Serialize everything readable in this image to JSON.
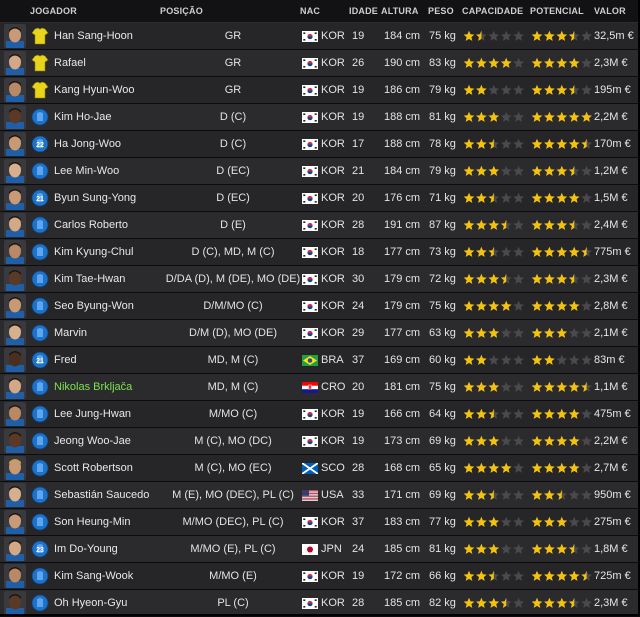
{
  "columns": {
    "player": "JOGADOR",
    "position": "POSIÇÃO",
    "nat": "NAC",
    "age": "IDADE",
    "height": "ALTURA",
    "weight": "PESO",
    "ability": "CAPACIDADE",
    "potential": "POTENCIAL",
    "value": "VALOR"
  },
  "colors": {
    "star_gold": "#f2c20f",
    "star_empty": "#4a4a4e",
    "highlight_name": "#7ee04f",
    "kit_gk": "#e8d41a",
    "kit_outfield": "#1e73c8"
  },
  "players": [
    {
      "name": "Han Sang-Hoon",
      "kit": "gk",
      "number": "",
      "position": "GR",
      "flag": "kor",
      "nat": "KOR",
      "age": "19",
      "height": "184 cm",
      "weight": "75 kg",
      "ability": 1.5,
      "potential": 3.5,
      "value": "32,5m €",
      "highlight": false
    },
    {
      "name": "Rafael",
      "kit": "gk",
      "number": "",
      "position": "GR",
      "flag": "kor",
      "nat": "KOR",
      "age": "26",
      "height": "190 cm",
      "weight": "83 kg",
      "ability": 4,
      "potential": 4,
      "value": "2,3M €",
      "highlight": false
    },
    {
      "name": "Kang Hyun-Woo",
      "kit": "gk",
      "number": "",
      "position": "GR",
      "flag": "kor",
      "nat": "KOR",
      "age": "19",
      "height": "186 cm",
      "weight": "79 kg",
      "ability": 2,
      "potential": 3.5,
      "value": "195m €",
      "highlight": false
    },
    {
      "name": "Kim Ho-Jae",
      "kit": "out",
      "number": "",
      "position": "D (C)",
      "flag": "kor",
      "nat": "KOR",
      "age": "19",
      "height": "188 cm",
      "weight": "81 kg",
      "ability": 3,
      "potential": 5,
      "value": "2,2M €",
      "highlight": false
    },
    {
      "name": "Ha Jong-Woo",
      "kit": "out",
      "number": "22",
      "position": "D (C)",
      "flag": "kor",
      "nat": "KOR",
      "age": "17",
      "height": "188 cm",
      "weight": "78 kg",
      "ability": 2.5,
      "potential": 4.5,
      "value": "170m €",
      "highlight": false
    },
    {
      "name": "Lee Min-Woo",
      "kit": "out",
      "number": "",
      "position": "D (EC)",
      "flag": "kor",
      "nat": "KOR",
      "age": "21",
      "height": "184 cm",
      "weight": "79 kg",
      "ability": 3,
      "potential": 3.5,
      "value": "1,2M €",
      "highlight": false
    },
    {
      "name": "Byun Sung-Yong",
      "kit": "out",
      "number": "21",
      "position": "D (EC)",
      "flag": "kor",
      "nat": "KOR",
      "age": "20",
      "height": "176 cm",
      "weight": "71 kg",
      "ability": 2.5,
      "potential": 4,
      "value": "1,5M €",
      "highlight": false
    },
    {
      "name": "Carlos Roberto",
      "kit": "out",
      "number": "",
      "position": "D (E)",
      "flag": "kor",
      "nat": "KOR",
      "age": "28",
      "height": "191 cm",
      "weight": "87 kg",
      "ability": 3.5,
      "potential": 3.5,
      "value": "2,4M €",
      "highlight": false
    },
    {
      "name": "Kim Kyung-Chul",
      "kit": "out",
      "number": "",
      "position": "D (C), MD, M (C)",
      "flag": "kor",
      "nat": "KOR",
      "age": "18",
      "height": "177 cm",
      "weight": "73 kg",
      "ability": 2.5,
      "potential": 4.5,
      "value": "775m €",
      "highlight": false
    },
    {
      "name": "Kim Tae-Hwan",
      "kit": "out",
      "number": "",
      "position": "D/DA (D), M (DE), MO (DE)",
      "flag": "kor",
      "nat": "KOR",
      "age": "30",
      "height": "179 cm",
      "weight": "72 kg",
      "ability": 3.5,
      "potential": 3.5,
      "value": "2,3M €",
      "highlight": false
    },
    {
      "name": "Seo Byung-Won",
      "kit": "out",
      "number": "",
      "position": "D/M/MO (C)",
      "flag": "kor",
      "nat": "KOR",
      "age": "24",
      "height": "179 cm",
      "weight": "75 kg",
      "ability": 4,
      "potential": 4,
      "value": "2,8M €",
      "highlight": false
    },
    {
      "name": "Marvin",
      "kit": "out",
      "number": "",
      "position": "D/M (D), MO (DE)",
      "flag": "kor",
      "nat": "KOR",
      "age": "29",
      "height": "177 cm",
      "weight": "63 kg",
      "ability": 3,
      "potential": 3,
      "value": "2,1M €",
      "highlight": false
    },
    {
      "name": "Fred",
      "kit": "out",
      "number": "21",
      "position": "MD, M (C)",
      "flag": "bra",
      "nat": "BRA",
      "age": "37",
      "height": "169 cm",
      "weight": "60 kg",
      "ability": 2,
      "potential": 2,
      "value": "83m €",
      "highlight": false
    },
    {
      "name": "Nikolas Brkljača",
      "kit": "out",
      "number": "",
      "position": "MD, M (C)",
      "flag": "cro",
      "nat": "CRO",
      "age": "20",
      "height": "181 cm",
      "weight": "75 kg",
      "ability": 3,
      "potential": 4.5,
      "value": "1,1M €",
      "highlight": true
    },
    {
      "name": "Lee Jung-Hwan",
      "kit": "out",
      "number": "",
      "position": "M/MO (C)",
      "flag": "kor",
      "nat": "KOR",
      "age": "19",
      "height": "166 cm",
      "weight": "64 kg",
      "ability": 2.5,
      "potential": 4,
      "value": "475m €",
      "highlight": false
    },
    {
      "name": "Jeong Woo-Jae",
      "kit": "out",
      "number": "",
      "position": "M (C), MO (DC)",
      "flag": "kor",
      "nat": "KOR",
      "age": "19",
      "height": "173 cm",
      "weight": "69 kg",
      "ability": 3,
      "potential": 4,
      "value": "2,2M €",
      "highlight": false
    },
    {
      "name": "Scott Robertson",
      "kit": "out",
      "number": "",
      "position": "M (C), MO (EC)",
      "flag": "sco",
      "nat": "SCO",
      "age": "28",
      "height": "168 cm",
      "weight": "65 kg",
      "ability": 4,
      "potential": 4,
      "value": "2,7M €",
      "highlight": false
    },
    {
      "name": "Sebastián Saucedo",
      "kit": "out",
      "number": "",
      "position": "M (E), MO (DEC), PL (C)",
      "flag": "usa",
      "nat": "USA",
      "age": "33",
      "height": "171 cm",
      "weight": "69 kg",
      "ability": 2.5,
      "potential": 2.5,
      "value": "950m €",
      "highlight": false
    },
    {
      "name": "Son Heung-Min",
      "kit": "out",
      "number": "",
      "position": "M/MO (DEC), PL (C)",
      "flag": "kor",
      "nat": "KOR",
      "age": "37",
      "height": "183 cm",
      "weight": "77 kg",
      "ability": 3,
      "potential": 3,
      "value": "275m €",
      "highlight": false
    },
    {
      "name": "Im Do-Young",
      "kit": "out",
      "number": "23",
      "position": "M/MO (E), PL (C)",
      "flag": "jpn",
      "nat": "JPN",
      "age": "24",
      "height": "185 cm",
      "weight": "81 kg",
      "ability": 3,
      "potential": 3.5,
      "value": "1,8M €",
      "highlight": false
    },
    {
      "name": "Kim Sang-Wook",
      "kit": "out",
      "number": "",
      "position": "M/MO (E)",
      "flag": "kor",
      "nat": "KOR",
      "age": "19",
      "height": "172 cm",
      "weight": "66 kg",
      "ability": 2.5,
      "potential": 4.5,
      "value": "725m €",
      "highlight": false
    },
    {
      "name": "Oh Hyeon-Gyu",
      "kit": "out",
      "number": "",
      "position": "PL (C)",
      "flag": "kor",
      "nat": "KOR",
      "age": "28",
      "height": "185 cm",
      "weight": "82 kg",
      "ability": 3.5,
      "potential": 3.5,
      "value": "2,3M €",
      "highlight": false
    }
  ]
}
